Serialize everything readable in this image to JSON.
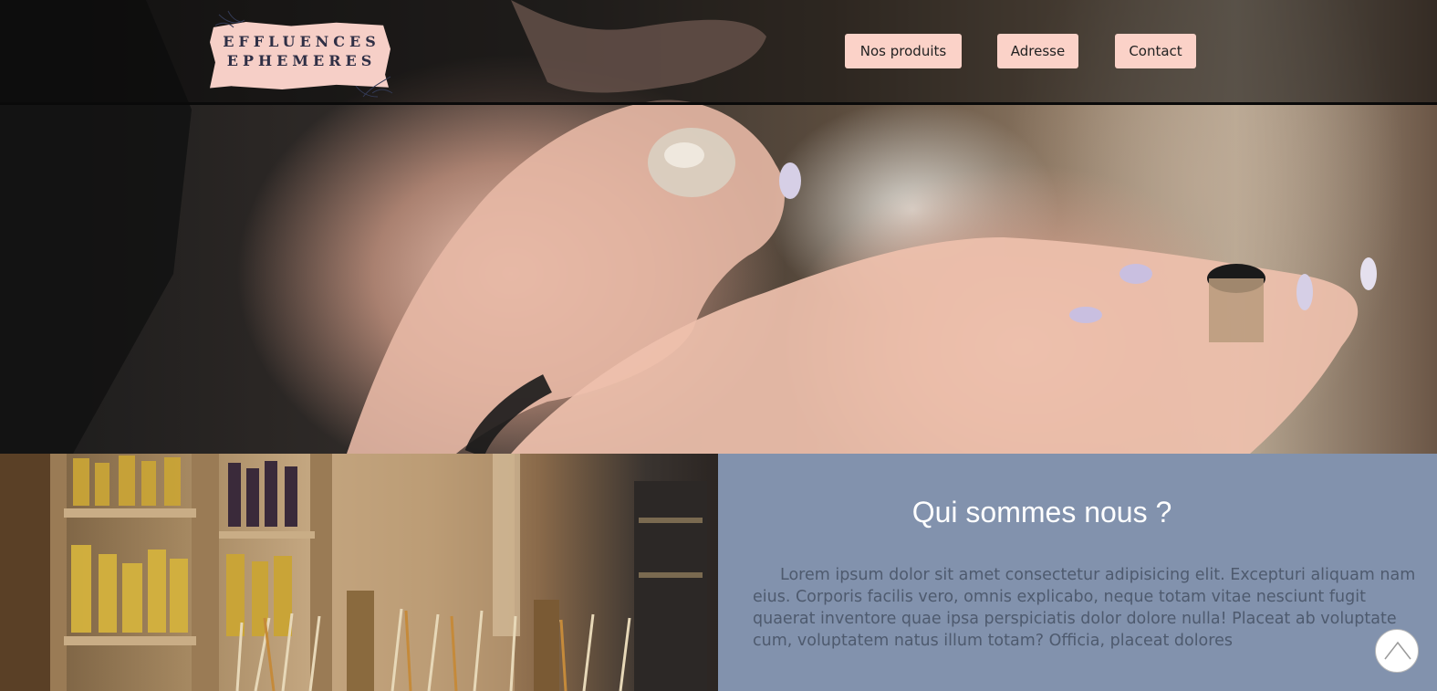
{
  "header": {
    "logo_line1": "EFFLUENCES",
    "logo_line2": "EPHEMERES",
    "nav": [
      "Nos produits",
      "Adresse",
      "Contact"
    ]
  },
  "hero": {
    "image": "perfume-application-photo"
  },
  "shop": {
    "image": "perfume-shop-shelves-photo"
  },
  "about": {
    "title": "Qui sommes nous ?",
    "text": "Lorem ipsum dolor sit amet consectetur adipisicing elit. Excepturi aliquam nam eius. Corporis facilis vero, omnis explicabo, neque totam vitae nesciunt fugit quaerat inventore quae ipsa perspiciatis dolor dolore nulla! Placeat ab voluptate cum, voluptatem natus illum totam? Officia, placeat dolores"
  },
  "scroll_top": {
    "icon": "chevron-up-icon"
  },
  "colors": {
    "nav_button": "#fbd2c8",
    "about_bg": "#8292ad",
    "about_text": "#4e5a6e",
    "logo_paper": "#f6cfc7"
  }
}
